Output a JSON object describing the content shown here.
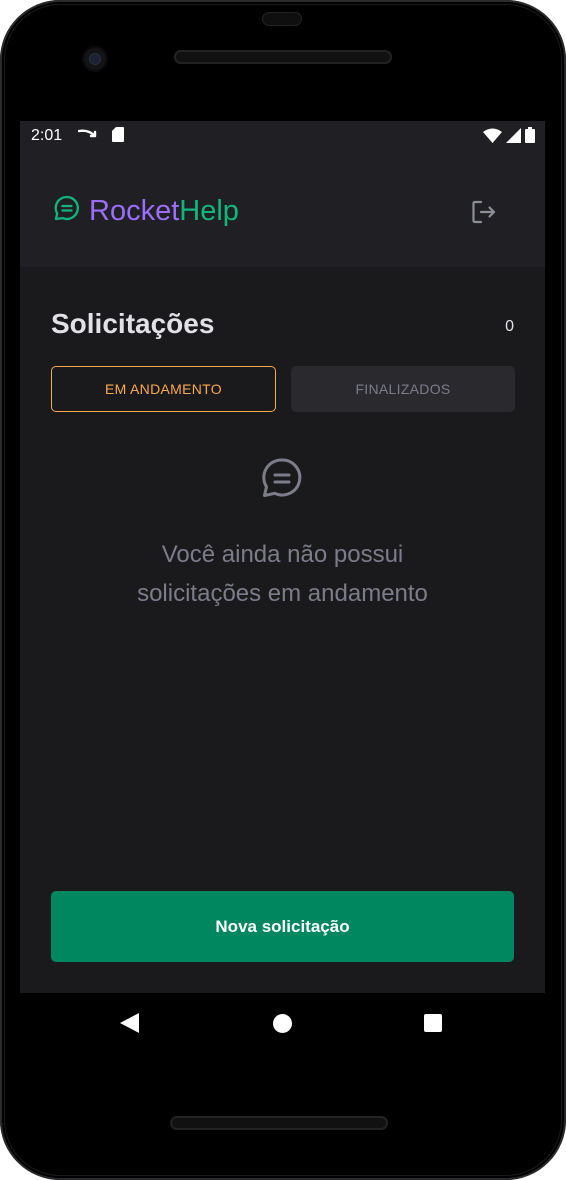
{
  "status_bar": {
    "time": "2:01",
    "icons": [
      "route-arrow-icon",
      "sd-card-icon",
      "wifi-icon",
      "signal-icon",
      "battery-icon"
    ]
  },
  "header": {
    "logo_icon": "chat-bubble-icon",
    "logo_part1": "Rocket",
    "logo_part2": "Help",
    "logout_icon": "sign-out-icon"
  },
  "main": {
    "title": "Solicitações",
    "count": "0",
    "tabs": [
      {
        "label": "EM ANDAMENTO",
        "active": true
      },
      {
        "label": "FINALIZADOS",
        "active": false
      }
    ],
    "empty_icon": "chat-bubble-icon",
    "empty_line1": "Você ainda não possui",
    "empty_line2": "solicitações em andamento",
    "new_button_label": "Nova solicitação"
  },
  "nav_bar": {
    "icons": [
      "back-triangle-icon",
      "home-circle-icon",
      "recent-square-icon"
    ]
  },
  "colors": {
    "brand_purple": "#9b6dff",
    "brand_green": "#11b77a",
    "accent_orange": "#fba94c",
    "button_green": "#00875f",
    "background": "#1a1a1d",
    "header_bg": "#202024"
  }
}
